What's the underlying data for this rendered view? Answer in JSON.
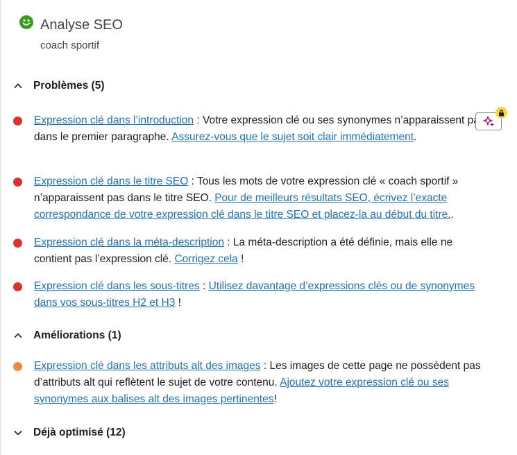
{
  "header": {
    "title": "Analyse SEO",
    "focus_keyphrase": "coach sportif",
    "status_color": "#3a9d1f"
  },
  "colors": {
    "problem": "#dc3232",
    "improvement": "#ee8a3e",
    "link": "#2271b1"
  },
  "sections": {
    "problems": {
      "label": "Problèmes (5)",
      "expanded": true,
      "items": [
        {
          "link": "Expression clé dans l’introduction",
          "text": " : Votre expression clé ou ses synonymes n’apparaissent pas dans le premier paragraphe. ",
          "action": "Assurez-vous que le sujet soit clair immédiatement",
          "end": "."
        },
        {
          "link": "Expression clé dans le titre SEO",
          "text": " : Tous les mots de votre expression clé « coach sportif » n’apparaissent pas dans le titre SEO. ",
          "action": "Pour de meilleurs résultats SEO, écrivez l’exacte correspondance de votre expression clé dans le titre SEO et placez-la au début du titre.",
          "end": "."
        },
        {
          "link": "Expression clé dans la méta-description",
          "text": " : La méta-description a été définie, mais elle ne contient pas l’expression clé. ",
          "action": "Corrigez cela",
          "end": " !"
        },
        {
          "link": "Expression clé dans les sous-titres",
          "text": " : ",
          "action": "Utilisez davantage d’expressions clés ou de synonymes dans vos sous-titres H2 et H3",
          "end": " !"
        }
      ]
    },
    "improvements": {
      "label": "Améliorations (1)",
      "expanded": true,
      "items": [
        {
          "link": "Expression clé dans les attributs alt des images",
          "text": " : Les images de cette page ne possèdent pas d’attributs alt qui reflètent le sujet de votre contenu. ",
          "action": "Ajoutez votre expression clé ou ses synonymes aux balises alt des images pertinentes",
          "end": "!"
        }
      ]
    },
    "good": {
      "label": "Déjà optimisé (12)",
      "expanded": false
    }
  },
  "ai_button": {
    "icon": "sparkle-icon",
    "locked": true,
    "lock_icon": "lock-icon"
  }
}
